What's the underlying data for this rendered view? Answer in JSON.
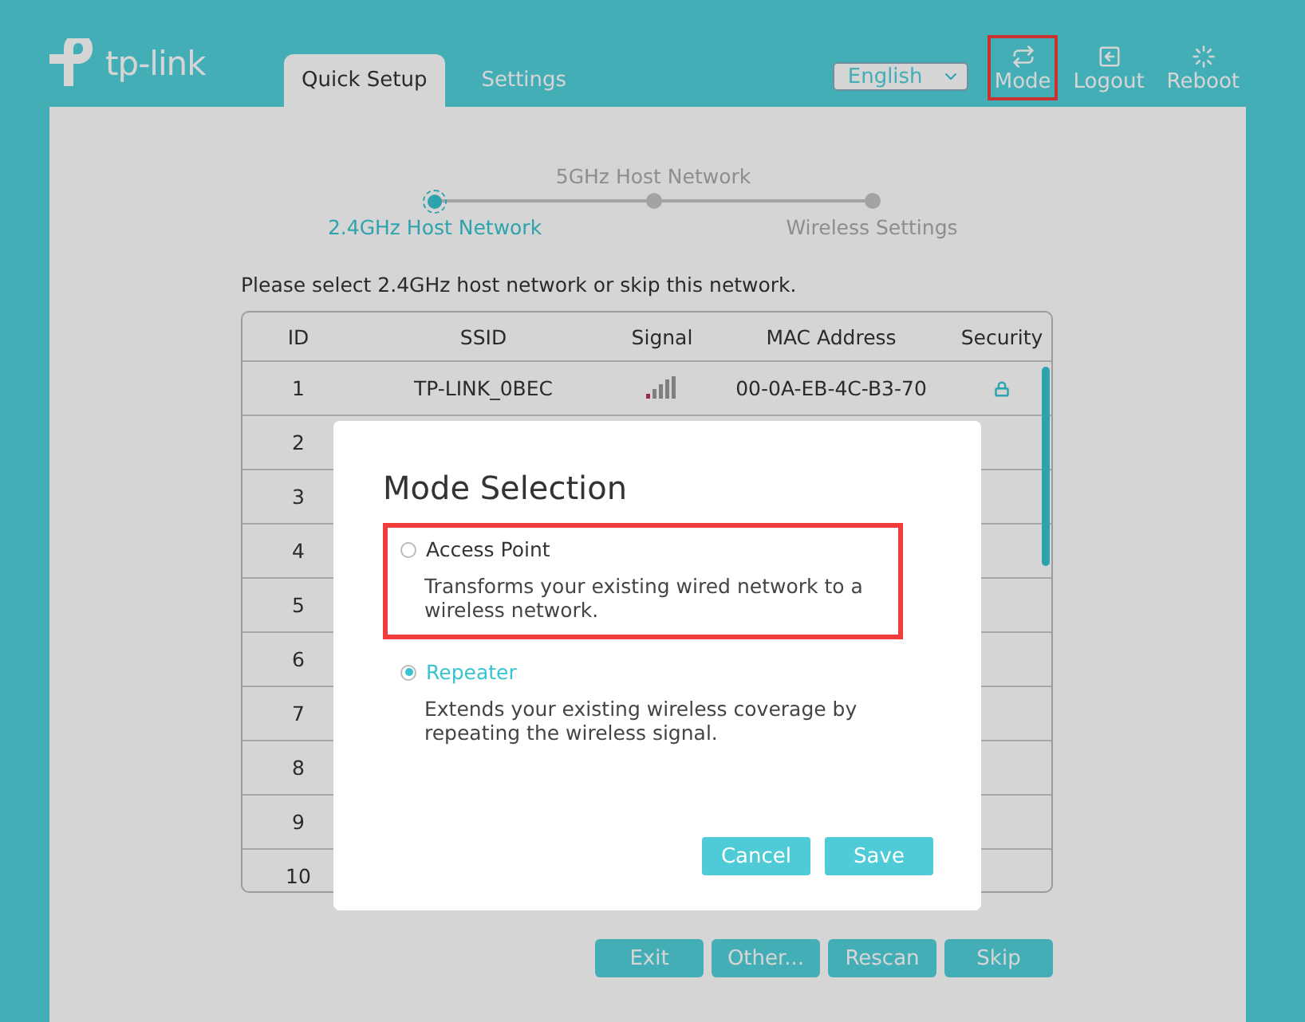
{
  "header": {
    "logo_text": "tp-link",
    "tabs": [
      {
        "label": "Quick Setup",
        "selected": true
      },
      {
        "label": "Settings",
        "selected": false
      }
    ],
    "language": "English",
    "nav": [
      {
        "label": "Mode",
        "kind": "mode",
        "highlighted": true
      },
      {
        "label": "Logout",
        "kind": "logout",
        "highlighted": false
      },
      {
        "label": "Reboot",
        "kind": "reboot",
        "highlighted": false
      }
    ]
  },
  "stepper": [
    {
      "label": "2.4GHz Host Network",
      "active": true
    },
    {
      "label": "5GHz Host Network",
      "active": false
    },
    {
      "label": "Wireless Settings",
      "active": false
    }
  ],
  "instruction": "Please select 2.4GHz host network or skip this network.",
  "table": {
    "columns": [
      "ID",
      "SSID",
      "Signal",
      "MAC Address",
      "Security"
    ],
    "rows": [
      {
        "id": "1",
        "ssid": "TP-LINK_0BEC",
        "mac": "00-0A-EB-4C-B3-70",
        "secured": true
      },
      {
        "id": "2"
      },
      {
        "id": "3"
      },
      {
        "id": "4"
      },
      {
        "id": "5"
      },
      {
        "id": "6"
      },
      {
        "id": "7"
      },
      {
        "id": "8"
      },
      {
        "id": "9"
      },
      {
        "id": "10"
      }
    ]
  },
  "buttons": [
    "Exit",
    "Other...",
    "Rescan",
    "Skip"
  ],
  "dialog": {
    "title": "Mode Selection",
    "options": [
      {
        "label": "Access Point",
        "description": "Transforms your existing wired network to a wireless network.",
        "selected": false,
        "highlighted": true
      },
      {
        "label": "Repeater",
        "description": "Extends your existing wireless coverage by repeating the wireless signal.",
        "selected": true,
        "highlighted": false
      }
    ],
    "buttons": [
      "Cancel",
      "Save"
    ]
  }
}
